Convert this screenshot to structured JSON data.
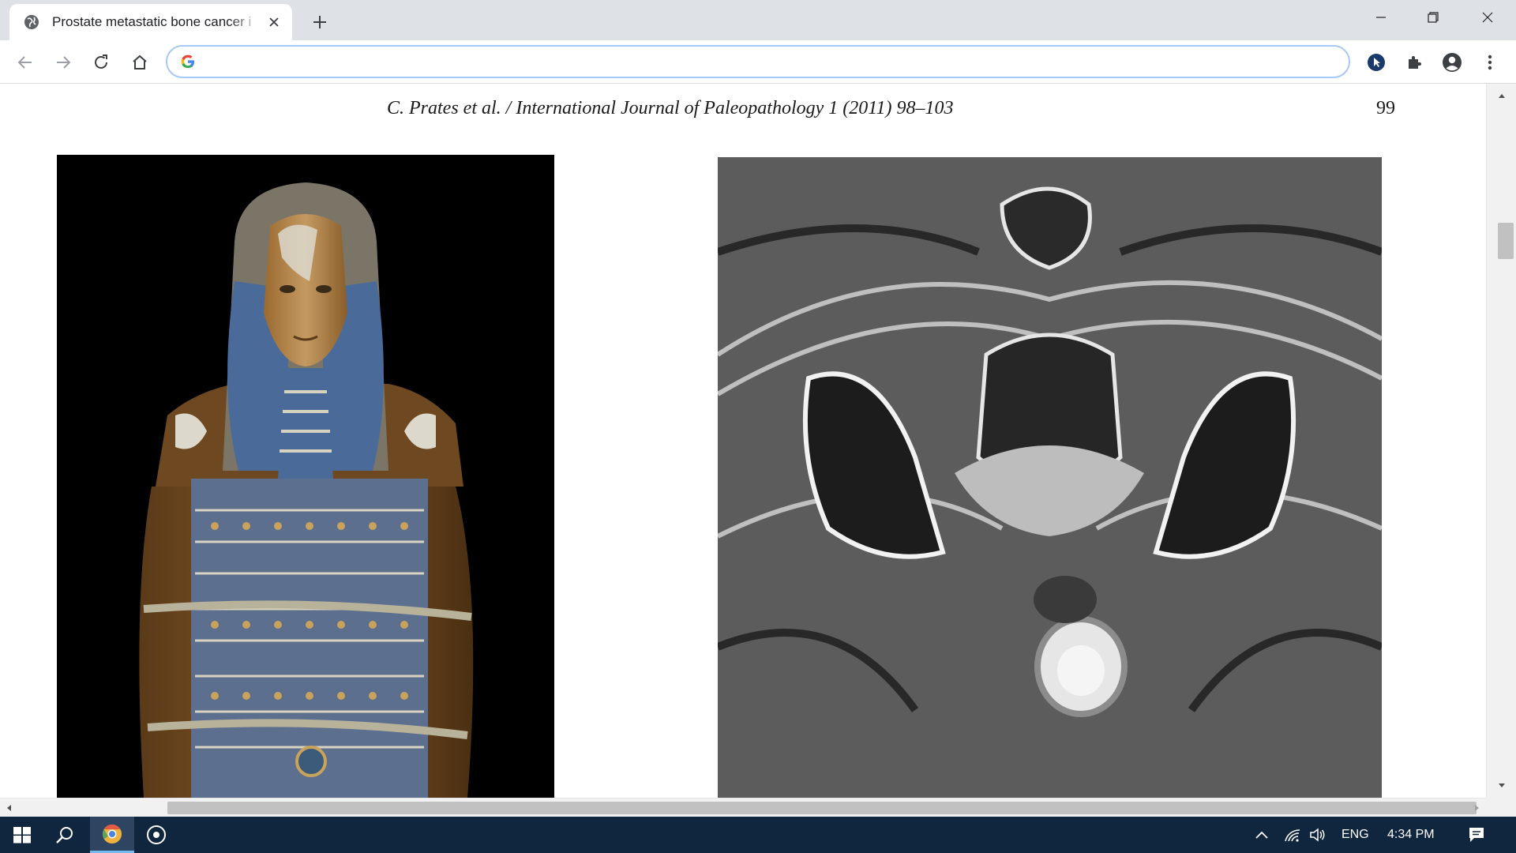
{
  "browser": {
    "tab": {
      "title": "Prostate metastatic bone cancer i",
      "favicon": "globe-icon"
    },
    "omnibox": {
      "value": "",
      "placeholder": ""
    },
    "toolbar_icons": [
      "back-icon",
      "forward-icon",
      "reload-icon",
      "home-icon",
      "extension-cursor-icon",
      "puzzle-icon",
      "profile-icon",
      "kebab-menu-icon"
    ],
    "window_controls": [
      "minimize-icon",
      "restore-icon",
      "close-icon"
    ]
  },
  "page": {
    "running_header": "C. Prates et al. / International Journal of Paleopathology 1 (2011) 98–103",
    "page_number": "99",
    "figures": [
      {
        "id": "left",
        "description_icon": "mummy-cartonnage-photo"
      },
      {
        "id": "right",
        "description_icon": "pelvis-mri-scan"
      }
    ]
  },
  "taskbar": {
    "lang": "ENG",
    "time": "4:34 PM",
    "icons": [
      "windows-start-icon",
      "search-icon",
      "chrome-icon",
      "media-app-icon",
      "chevron-up-icon",
      "wifi-icon",
      "volume-icon",
      "notification-icon"
    ]
  },
  "colors": {
    "tabstrip": "#dee1e6",
    "omnibox_border": "#a8c7fa",
    "taskbar": "#10253e",
    "taskbar_active": "#2d4560",
    "taskbar_accent": "#76b9ed"
  }
}
